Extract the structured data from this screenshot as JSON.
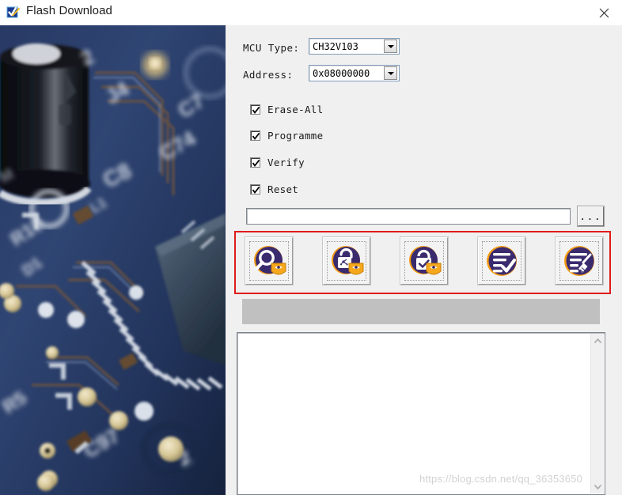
{
  "window": {
    "title": "Flash Download",
    "app_icon": "checkmark-shield-icon",
    "close_label": "✕"
  },
  "form": {
    "mcu_type": {
      "label": "MCU Type:",
      "value": "CH32V103"
    },
    "address": {
      "label": "Address:",
      "value": "0x08000000"
    },
    "options": [
      {
        "label": "Erase-All",
        "checked": true
      },
      {
        "label": "Programme",
        "checked": true
      },
      {
        "label": "Verify",
        "checked": true
      },
      {
        "label": "Reset",
        "checked": true
      }
    ],
    "file_path": {
      "value": "",
      "placeholder": "",
      "browse_label": "..."
    }
  },
  "toolbar": {
    "highlight_color": "#e01b1b",
    "buttons": [
      {
        "name": "query-chip",
        "icon": "magnifier-shield-icon"
      },
      {
        "name": "unlock-chip",
        "icon": "unlock-shield-icon"
      },
      {
        "name": "lock-chip",
        "icon": "lock-shield-icon"
      },
      {
        "name": "verify-list",
        "icon": "list-check-icon"
      },
      {
        "name": "clear-list",
        "icon": "list-broom-icon"
      }
    ]
  },
  "progress": {
    "value": 0,
    "text": ""
  },
  "log": {
    "text": "",
    "scroll_up_icon": "chevron-up-icon",
    "scroll_down_icon": "chevron-down-icon"
  },
  "watermark": {
    "text": "https://blog.csdn.net/qq_36353650"
  },
  "photo": {
    "alt": "blurred circuit board photo"
  }
}
